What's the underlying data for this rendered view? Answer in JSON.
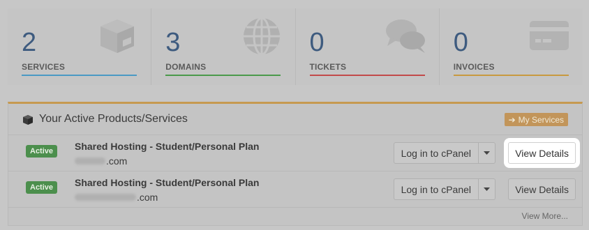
{
  "tiles": [
    {
      "count": "2",
      "label": "SERVICES",
      "icon": "box-icon",
      "color": "#4a9ac4"
    },
    {
      "count": "3",
      "label": "DOMAINS",
      "icon": "globe-icon",
      "color": "#4b9a4b"
    },
    {
      "count": "0",
      "label": "TICKETS",
      "icon": "chat-bubbles-icon",
      "color": "#c24a4a"
    },
    {
      "count": "0",
      "label": "INVOICES",
      "icon": "credit-card-icon",
      "color": "#c89a40"
    }
  ],
  "panel": {
    "title": "Your Active Products/Services",
    "my_services_label": "My Services",
    "view_more_label": "View More...",
    "accent": "#c69a50"
  },
  "products": [
    {
      "status": "Active",
      "name": "Shared Hosting - Student/Personal Plan",
      "domain_suffix": ".com",
      "cpanel_label": "Log in to cPanel",
      "details_label": "View Details"
    },
    {
      "status": "Active",
      "name": "Shared Hosting - Student/Personal Plan",
      "domain_suffix": ".com",
      "cpanel_label": "Log in to cPanel",
      "details_label": "View Details"
    }
  ]
}
